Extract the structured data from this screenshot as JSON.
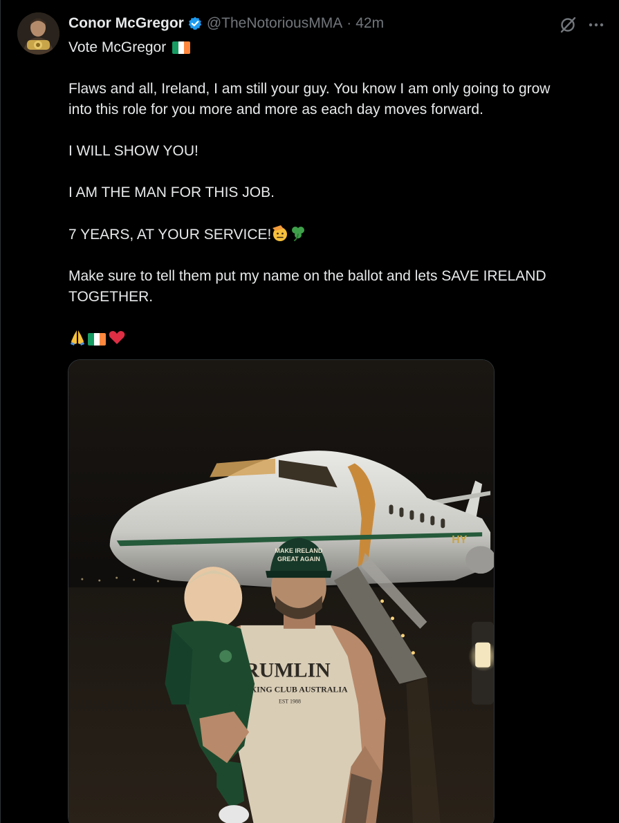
{
  "author": {
    "name": "Conor McGregor",
    "handle": "@TheNotoriousMMA",
    "time": "42m",
    "separator": "·"
  },
  "tweet": {
    "lines": [
      "Vote McGregor",
      "Flaws and all, Ireland, I am still your guy. You know I am only going to grow",
      "into this role for you more and more as each day moves forward.",
      "I WILL SHOW YOU!",
      "I AM THE MAN FOR THIS JOB.",
      "7 YEARS, AT YOUR SERVICE!",
      "Make sure to tell them put my name on the ballot and lets SAVE IRELAND",
      "TOGETHER."
    ]
  },
  "media": {
    "plane_tail_text": "HY",
    "hat_text_1": "MAKE IRELAND",
    "hat_text_2": "GREAT AGAIN",
    "shirt_text_1": "RUMLIN",
    "shirt_text_2": "OXING CLUB AUSTRALIA",
    "shirt_text_3": "EST 1988"
  },
  "colors": {
    "background": "#000000",
    "text": "#e7e9ea",
    "muted": "#71767b",
    "verified": "#1d9bf0",
    "flag_green": "#169b62",
    "flag_white": "#ffffff",
    "flag_orange": "#ff883e"
  }
}
